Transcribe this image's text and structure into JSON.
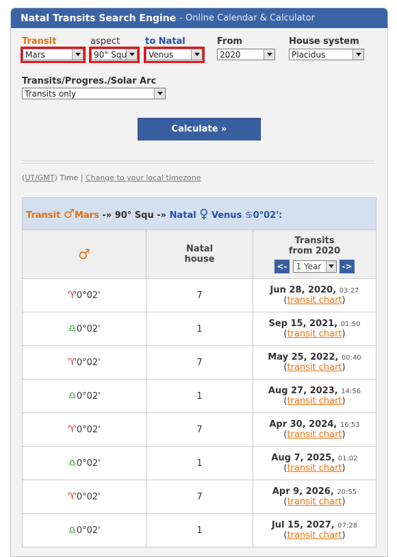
{
  "header": {
    "title": "Natal Transits Search Engine",
    "subtitle": "- Online Calendar & Calculator"
  },
  "form": {
    "transit_label": "Transit",
    "transit_value": "Mars",
    "aspect_label": "aspect",
    "aspect_value": "90° Squ",
    "natal_label": "to Natal",
    "natal_value": "Venus",
    "from_label": "From",
    "from_value": "2020",
    "house_label": "House system",
    "house_value": "Placidus",
    "mode_label": "Transits/Progres./Solar Arc",
    "mode_value": "Transits only",
    "calculate_label": "Calculate »"
  },
  "timezone": {
    "ut_gmt": "UT/GMT",
    "time": "Time",
    "sep": "|",
    "change_link": "Change to your local timezone"
  },
  "results": {
    "title_transit": "Transit",
    "title_planet_symbol": "♂",
    "title_planet": "Mars",
    "title_arrow1": "-»",
    "title_aspect": "90° Squ",
    "title_arrow2": "-»",
    "title_natal": "Natal",
    "title_natal_symbol": "♀",
    "title_natal_planet": "Venus",
    "title_sign_symbol": "♋",
    "title_degree": "0°02':",
    "col_planet_symbol": "♂",
    "col_house": "Natal house",
    "col_transits": "Transits",
    "col_from": "from 2020",
    "prev_label": "<-",
    "next_label": "->",
    "period_value": "1 Year",
    "rows": [
      {
        "sign": "♈",
        "deg": "0°02'",
        "house": "7",
        "date": "Jun 28, 2020",
        "time": "03:27",
        "link": "transit chart"
      },
      {
        "sign": "♎",
        "deg": "0°02'",
        "house": "1",
        "date": "Sep 15, 2021",
        "time": "01:50",
        "link": "transit chart"
      },
      {
        "sign": "♈",
        "deg": "0°02'",
        "house": "7",
        "date": "May 25, 2022",
        "time": "00:40",
        "link": "transit chart"
      },
      {
        "sign": "♎",
        "deg": "0°02'",
        "house": "1",
        "date": "Aug 27, 2023",
        "time": "14:56",
        "link": "transit chart"
      },
      {
        "sign": "♈",
        "deg": "0°02'",
        "house": "7",
        "date": "Apr 30, 2024",
        "time": "16:53",
        "link": "transit chart"
      },
      {
        "sign": "♎",
        "deg": "0°02'",
        "house": "1",
        "date": "Aug 7, 2025",
        "time": "01:02",
        "link": "transit chart"
      },
      {
        "sign": "♈",
        "deg": "0°02'",
        "house": "7",
        "date": "Apr 9, 2026",
        "time": "20:55",
        "link": "transit chart"
      },
      {
        "sign": "♎",
        "deg": "0°02'",
        "house": "1",
        "date": "Jul 15, 2027",
        "time": "07:28",
        "link": "transit chart"
      }
    ]
  }
}
